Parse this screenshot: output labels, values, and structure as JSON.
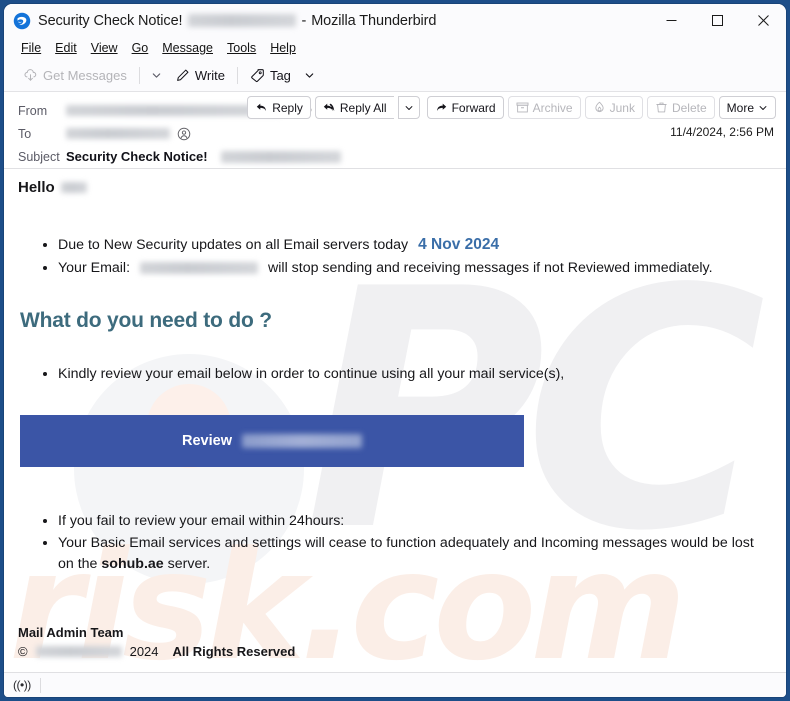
{
  "window": {
    "app_name": "Mozilla Thunderbird",
    "title_subject": "Security Check Notice!",
    "title_separator": "-",
    "logo_icon": "thunderbird-logo-icon",
    "controls": {
      "minimize": "minimize-icon",
      "maximize": "maximize-icon",
      "close": "close-icon"
    }
  },
  "menubar": {
    "items": [
      {
        "label": "File"
      },
      {
        "label": "Edit"
      },
      {
        "label": "View"
      },
      {
        "label": "Go"
      },
      {
        "label": "Message"
      },
      {
        "label": "Tools"
      },
      {
        "label": "Help"
      }
    ]
  },
  "toolbar": {
    "get_messages": "Get Messages",
    "get_messages_icon": "download-cloud-icon",
    "get_messages_caret": "chevron-down-icon",
    "write": "Write",
    "write_icon": "pencil-icon",
    "tag": "Tag",
    "tag_icon": "tag-icon",
    "tag_caret": "chevron-down-icon"
  },
  "message_header": {
    "from_label": "From",
    "to_label": "To",
    "subject_label": "Subject",
    "subject_value": "Security Check Notice!",
    "date": "11/4/2024, 2:56 PM",
    "contact_icon": "contact-card-icon",
    "actions": [
      {
        "label": "Reply",
        "icon": "reply-icon",
        "disabled": false
      },
      {
        "label": "Reply All",
        "icon": "reply-all-icon",
        "disabled": false
      },
      {
        "label": "",
        "icon": "chevron-down-icon",
        "disabled": false
      },
      {
        "label": "Forward",
        "icon": "forward-icon",
        "disabled": false
      },
      {
        "label": "Archive",
        "icon": "archive-box-icon",
        "disabled": true
      },
      {
        "label": "Junk",
        "icon": "junk-flame-icon",
        "disabled": true
      },
      {
        "label": "Delete",
        "icon": "trash-icon",
        "disabled": true
      },
      {
        "label": "More",
        "icon": "chevron-down-icon",
        "disabled": false
      }
    ]
  },
  "email_body": {
    "greeting": "Hello",
    "bullets_top": [
      {
        "text": "Due to New Security updates on all Email servers today",
        "highlight": "4 Nov 2024"
      },
      {
        "prefix": "Your Email:",
        "suffix": "will stop sending and receiving messages if not Reviewed immediately."
      }
    ],
    "heading": "What do you need to do ?",
    "bullet_mid": "Kindly review your email below in order to continue using all your mail service(s),",
    "cta_label": "Review",
    "bullets_bottom": [
      "If you fail to review your email within 24hours:",
      {
        "part1": "Your Basic Email services and settings will cease to function adequately and Incoming messages would be lost on the",
        "bold": "sohub.ae",
        "part2": "server."
      }
    ],
    "footer_team": "Mail Admin Team",
    "footer_copyright_symbol": "©",
    "footer_year": "2024",
    "footer_rights": "All Rights Reserved"
  },
  "watermark": {
    "primary": "PC",
    "secondary": "risk.com"
  },
  "statusbar": {
    "connection_icon": "((•))"
  },
  "colors": {
    "window_border": "#1d4e89",
    "date_highlight": "#3a6ea8",
    "heading": "#3d6b7d",
    "cta_background": "#3b55a6",
    "cta_text": "#ffffff",
    "watermark_primary": "#f0f0f2",
    "watermark_secondary": "#fbeee7"
  }
}
